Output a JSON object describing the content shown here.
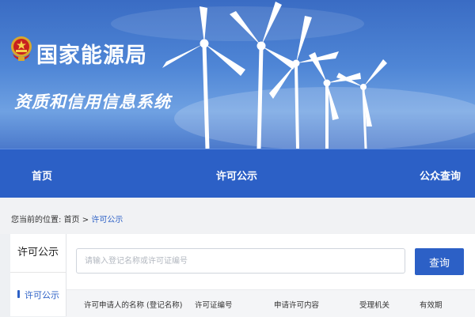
{
  "header": {
    "org_name": "国家能源局",
    "system_name": "资质和信用信息系统",
    "emblem_icon": "national-emblem-icon",
    "banner_colors": {
      "sky_top": "#3a6cc4",
      "sky_bottom": "#6fa1e2"
    }
  },
  "nav": {
    "items": [
      {
        "label": "首页"
      },
      {
        "label": "许可公示"
      },
      {
        "label": "公众查询"
      }
    ],
    "bg_color": "#2c60c6"
  },
  "breadcrumb": {
    "prefix": "您当前的位置:",
    "home": "首页",
    "separator": ">",
    "current": "许可公示"
  },
  "sidebar": {
    "title": "许可公示",
    "items": [
      {
        "label": "许可公示"
      }
    ]
  },
  "search": {
    "placeholder": "请输入登记名称或许可证编号",
    "value": "",
    "button_label": "查询"
  },
  "table": {
    "headers": [
      "许可申请人的名称 (登记名称)",
      "许可证编号",
      "申请许可内容",
      "受理机关",
      "有效期"
    ]
  },
  "colors": {
    "accent": "#2c60c6"
  }
}
